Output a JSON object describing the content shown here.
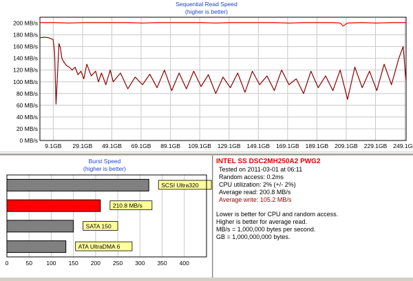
{
  "sequential": {
    "title": "Sequential Read Speed",
    "subtitle": "(higher is better)"
  },
  "burst": {
    "title": "Burst Speed",
    "subtitle": "(higher is better)"
  },
  "info": {
    "drive_name": "INTEL SS DSC2MH250A2 PWG2",
    "tested_on": "Tested on 2011-03-01 at 06:11",
    "random_access": "Random access: 0.2ms",
    "cpu_utilization": "CPU utilization: 2% (+/- 2%)",
    "average_read": "Average read: 200.8 MB/s",
    "average_write": "Average write: 105.2 MB/s",
    "note1": "Lower is better for CPU and random access.",
    "note2": "Higher is better for average read.",
    "note3": "MB/s = 1,000,000 bytes per second.",
    "note4": "GB = 1,000,000,000 bytes."
  },
  "colors": {
    "read_line": "#ff0000",
    "write_line": "#8b0000",
    "grid": "#c8c8c8",
    "title_blue": "#1f3fd0",
    "bar_gray": "#808080",
    "bar_highlight": "#ff0000",
    "label_yellow": "#ffff99",
    "write_text": "#a00000"
  },
  "chart_data": [
    {
      "type": "line",
      "title": "Sequential Read Speed",
      "subtitle": "(higher is better)",
      "y_tick_labels": [
        "0 MB/s",
        "20 MB/s",
        "40 MB/s",
        "60 MB/s",
        "80 MB/s",
        "100 MB/s",
        "120 MB/s",
        "140 MB/s",
        "160 MB/s",
        "180 MB/s",
        "200 MB/s"
      ],
      "x_tick_labels": [
        "9.1GB",
        "29.1GB",
        "49.1GB",
        "69.1GB",
        "89.1GB",
        "109.1GB",
        "129.1GB",
        "149.1GB",
        "169.1GB",
        "189.1GB",
        "209.1GB",
        "229.1GB",
        "249.1GB"
      ],
      "x_ticks": [
        9.1,
        29.1,
        49.1,
        69.1,
        89.1,
        109.1,
        129.1,
        149.1,
        169.1,
        189.1,
        209.1,
        229.1,
        249.1
      ],
      "xlim": [
        0,
        250
      ],
      "ylim": [
        0,
        210
      ],
      "grid": true,
      "series": [
        {
          "name": "read",
          "color": "#ff0000",
          "x": [
            0,
            10,
            20,
            30,
            40,
            50,
            60,
            70,
            80,
            90,
            100,
            110,
            120,
            130,
            140,
            150,
            160,
            170,
            180,
            190,
            200,
            205,
            207,
            210,
            220,
            230,
            240,
            250
          ],
          "y": [
            201,
            201,
            200,
            201,
            201,
            201,
            201,
            200,
            201,
            201,
            201,
            201,
            200,
            201,
            201,
            201,
            201,
            200,
            201,
            201,
            201,
            200,
            195,
            200,
            201,
            200,
            201,
            201
          ]
        },
        {
          "name": "write",
          "color": "#8b0000",
          "x": [
            0,
            3,
            6,
            9,
            10,
            11,
            13,
            14,
            15,
            16,
            18,
            20,
            22,
            24,
            26,
            28,
            30,
            32,
            35,
            38,
            40,
            42,
            45,
            48,
            50,
            55,
            60,
            65,
            70,
            75,
            80,
            85,
            90,
            95,
            100,
            105,
            110,
            115,
            120,
            125,
            130,
            135,
            140,
            145,
            150,
            155,
            160,
            165,
            170,
            175,
            180,
            185,
            190,
            195,
            200,
            205,
            210,
            215,
            220,
            225,
            230,
            235,
            240,
            245,
            248,
            250
          ],
          "y": [
            175,
            176,
            175,
            172,
            150,
            62,
            165,
            158,
            140,
            135,
            128,
            125,
            120,
            125,
            112,
            118,
            105,
            130,
            110,
            118,
            100,
            115,
            95,
            120,
            100,
            115,
            88,
            108,
            95,
            113,
            90,
            120,
            85,
            115,
            88,
            118,
            92,
            112,
            80,
            108,
            90,
            115,
            82,
            118,
            95,
            110,
            85,
            120,
            95,
            105,
            80,
            118,
            90,
            110,
            85,
            120,
            70,
            125,
            90,
            118,
            85,
            130,
            95,
            140,
            160,
            100
          ]
        }
      ]
    },
    {
      "type": "bar",
      "title": "Burst Speed",
      "subtitle": "(higher is better)",
      "orientation": "horizontal",
      "xlim": [
        0,
        450
      ],
      "x_tick_labels": [
        "0",
        "50",
        "100",
        "150",
        "200",
        "250",
        "300",
        "350",
        "400"
      ],
      "x_ticks": [
        0,
        50,
        100,
        150,
        200,
        250,
        300,
        350,
        400
      ],
      "categories": [
        "SCSI Ultra320",
        "210.8 MB/s",
        "SATA 150",
        "ATA UltraDMA 6"
      ],
      "values": [
        320,
        210.8,
        150,
        133
      ],
      "highlight_index": 1
    }
  ]
}
